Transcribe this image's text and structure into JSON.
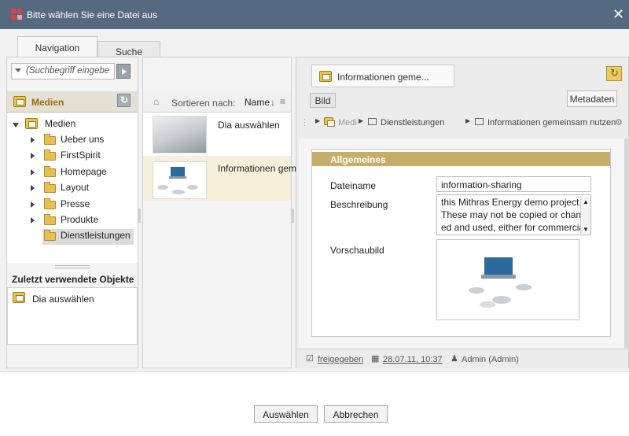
{
  "window": {
    "title": "Bitte wählen Sie eine Datei aus"
  },
  "tabs": {
    "navigation": "Navigation",
    "search": "Suche"
  },
  "search": {
    "placeholder": "(Suchbegriff eingebe"
  },
  "media": {
    "header": "Medien",
    "tree": [
      {
        "label": "Medien",
        "expanded": true
      },
      {
        "label": "Ueber uns"
      },
      {
        "label": "FirstSpirit"
      },
      {
        "label": "Homepage"
      },
      {
        "label": "Layout"
      },
      {
        "label": "Presse"
      },
      {
        "label": "Produkte"
      },
      {
        "label": "Dienstleistungen",
        "selected": true
      }
    ]
  },
  "recent": {
    "header": "Zuletzt verwendete Objekte",
    "items": [
      "Dia auswählen"
    ]
  },
  "sort": {
    "label": "Sortieren nach:",
    "field": "Name"
  },
  "list": [
    {
      "label": "Dia auswählen"
    },
    {
      "label": "Informationen gem"
    }
  ],
  "detail_tab": {
    "label": "Informationen geme..."
  },
  "buttons": {
    "bild": "Bild",
    "metadaten": "Metadaten",
    "select": "Auswählen",
    "cancel": "Abbrechen"
  },
  "breadcrumb": {
    "root": "Medi",
    "folder": "Dienstleistungen",
    "item": "Informationen gemeinsam nutzen"
  },
  "general": {
    "header": "Allgemeines",
    "filename_label": "Dateiname",
    "filename_value": "information-sharing",
    "description_label": "Beschreibung",
    "description_lines": [
      "this Mithras Energy demo project.",
      "These may not be copied or chang",
      "ed and used, either for commercial"
    ],
    "preview_label": "Vorschaubild"
  },
  "status": {
    "state": "freigegeben",
    "date": "28.07.11, 10:37",
    "user": "Admin (Admin)"
  },
  "colors": {
    "titlebar": "#556a80",
    "accent": "#c6ad6a",
    "media_text": "#9a6b10"
  }
}
